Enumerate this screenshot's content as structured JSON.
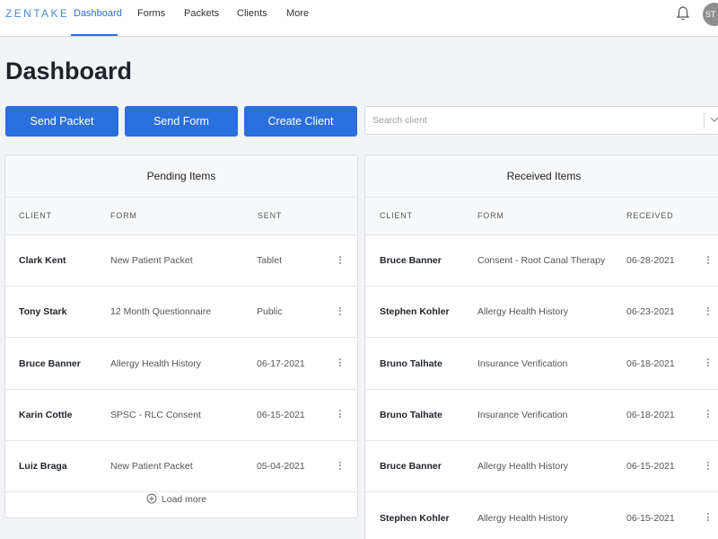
{
  "brand": {
    "logo": "ZENTAKE",
    "accent": "#2a6fdb"
  },
  "nav": {
    "items": [
      {
        "label": "Dashboard",
        "active": true
      },
      {
        "label": "Forms"
      },
      {
        "label": "Packets"
      },
      {
        "label": "Clients"
      },
      {
        "label": "More"
      }
    ],
    "notification_icon": "bell-icon",
    "avatar_initials": "ST"
  },
  "page": {
    "title": "Dashboard"
  },
  "actions": {
    "send_packet": "Send Packet",
    "send_form": "Send Form",
    "create_client": "Create Client"
  },
  "search": {
    "placeholder": "Search client",
    "value": ""
  },
  "pending": {
    "title": "Pending Items",
    "columns": [
      "CLIENT",
      "FORM",
      "SENT"
    ],
    "rows": [
      {
        "client": "Clark Kent",
        "form": "New Patient Packet",
        "date": "Tablet"
      },
      {
        "client": "Tony Stark",
        "form": "12 Month Questionnaire",
        "date": "Public"
      },
      {
        "client": "Bruce Banner",
        "form": "Allergy Health History",
        "date": "06-17-2021"
      },
      {
        "client": "Karin Cottle",
        "form": "SPSC - RLC Consent",
        "date": "06-15-2021"
      },
      {
        "client": "Luiz Braga",
        "form": "New Patient Packet",
        "date": "05-04-2021"
      }
    ],
    "load_more": "Load more"
  },
  "received": {
    "title": "Received Items",
    "columns": [
      "CLIENT",
      "FORM",
      "RECEIVED"
    ],
    "rows": [
      {
        "client": "Bruce Banner",
        "form": "Consent - Root Canal Therapy",
        "date": "06-28-2021"
      },
      {
        "client": "Stephen Kohler",
        "form": "Allergy Health History",
        "date": "06-23-2021"
      },
      {
        "client": "Bruno Talhate",
        "form": "Insurance Verification",
        "date": "06-18-2021"
      },
      {
        "client": "Bruno Talhate",
        "form": "Insurance Verification",
        "date": "06-18-2021"
      },
      {
        "client": "Bruce Banner",
        "form": "Allergy Health History",
        "date": "06-15-2021"
      },
      {
        "client": "Stephen Kohler",
        "form": "Allergy Health History",
        "date": "06-15-2021"
      }
    ]
  }
}
